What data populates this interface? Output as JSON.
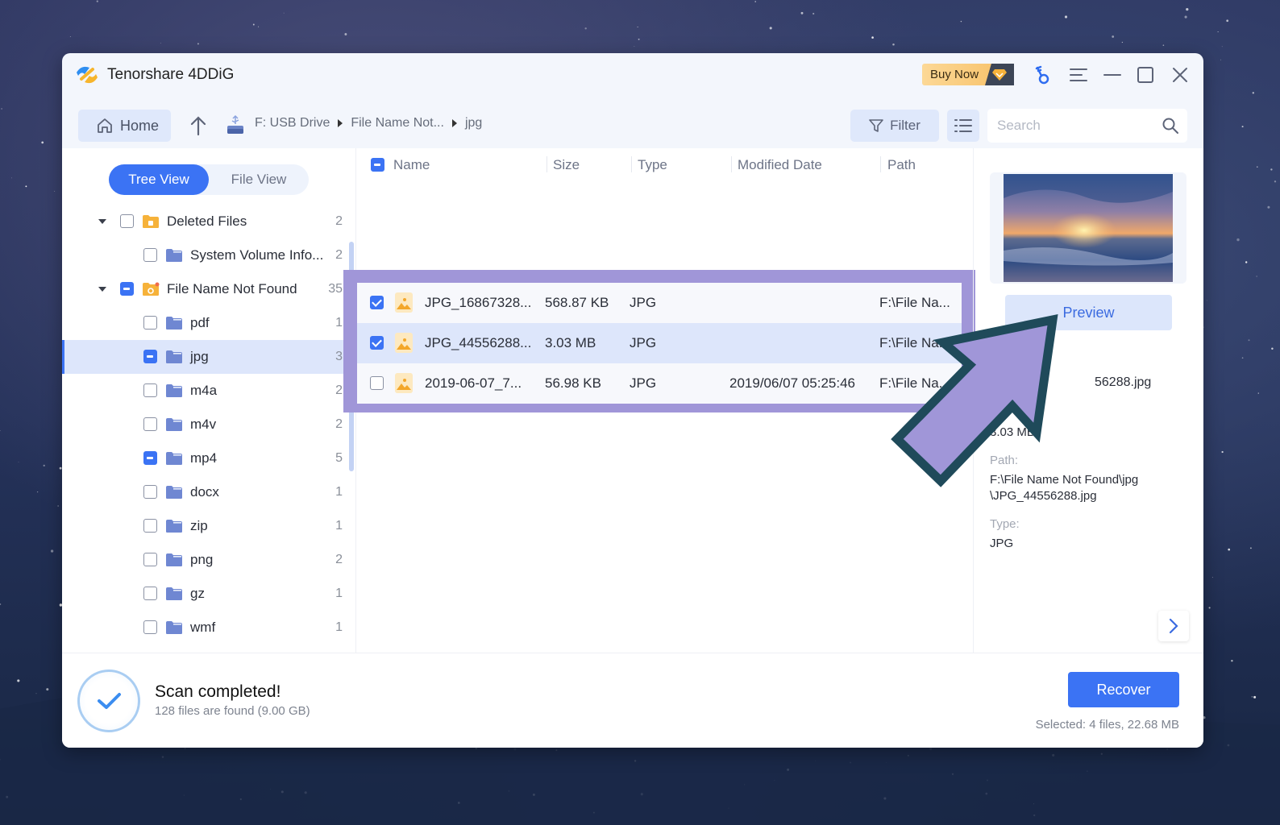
{
  "app": {
    "title": "Tenorshare 4DDiG",
    "buy_now_label": "Buy Now"
  },
  "titlebar_icons": [
    "key-icon",
    "menu-icon",
    "minimize-icon",
    "maximize-icon",
    "close-icon"
  ],
  "toolbar": {
    "home_label": "Home",
    "breadcrumb": [
      "F: USB Drive",
      "File Name Not...",
      "jpg"
    ],
    "filter_label": "Filter",
    "search_placeholder": "Search",
    "search_value": ""
  },
  "view_toggle": {
    "options": [
      "Tree View",
      "File View"
    ],
    "active": "Tree View"
  },
  "tree": [
    {
      "label": "Deleted Files",
      "count": "2",
      "level": 0,
      "expanded": true,
      "state": "unchecked",
      "folder": "trash-folder"
    },
    {
      "label": "System Volume Info...",
      "count": "2",
      "level": 1,
      "state": "unchecked",
      "folder": "folder"
    },
    {
      "label": "File Name Not Found",
      "count": "35",
      "level": 0,
      "expanded": true,
      "state": "partial",
      "folder": "unknown-folder"
    },
    {
      "label": "pdf",
      "count": "1",
      "level": 1,
      "state": "unchecked",
      "folder": "folder"
    },
    {
      "label": "jpg",
      "count": "3",
      "level": 1,
      "state": "partial",
      "folder": "folder",
      "selected": true
    },
    {
      "label": "m4a",
      "count": "2",
      "level": 1,
      "state": "unchecked",
      "folder": "folder"
    },
    {
      "label": "m4v",
      "count": "2",
      "level": 1,
      "state": "unchecked",
      "folder": "folder"
    },
    {
      "label": "mp4",
      "count": "5",
      "level": 1,
      "state": "partial",
      "folder": "folder"
    },
    {
      "label": "docx",
      "count": "1",
      "level": 1,
      "state": "unchecked",
      "folder": "folder"
    },
    {
      "label": "zip",
      "count": "1",
      "level": 1,
      "state": "unchecked",
      "folder": "folder"
    },
    {
      "label": "png",
      "count": "2",
      "level": 1,
      "state": "unchecked",
      "folder": "folder"
    },
    {
      "label": "gz",
      "count": "1",
      "level": 1,
      "state": "unchecked",
      "folder": "folder"
    },
    {
      "label": "wmf",
      "count": "1",
      "level": 1,
      "state": "unchecked",
      "folder": "folder"
    }
  ],
  "file_table": {
    "header_checkbox": "partial",
    "columns": [
      "Name",
      "Size",
      "Type",
      "Modified Date",
      "Path"
    ],
    "rows": [
      {
        "name": "JPG_16867328...",
        "size": "568.87 KB",
        "type": "JPG",
        "modified": "",
        "path": "F:\\File Na...",
        "checked": true,
        "selected": false
      },
      {
        "name": "JPG_44556288...",
        "size": "3.03 MB",
        "type": "JPG",
        "modified": "",
        "path": "F:\\File Na...",
        "checked": true,
        "selected": true
      },
      {
        "name": "2019-06-07_7...",
        "size": "56.98 KB",
        "type": "JPG",
        "modified": "2019/06/07 05:25:46",
        "path": "F:\\File Na...",
        "checked": false,
        "selected": false
      }
    ]
  },
  "details": {
    "preview_label": "Preview",
    "name_partial": "56288.jpg",
    "size_partial": "3.03 MB",
    "path_label": "Path:",
    "path_value_line1": "F:\\File Name Not Found\\jpg",
    "path_value_line2": "\\JPG_44556288.jpg",
    "type_label": "Type:",
    "type_value": "JPG"
  },
  "footer": {
    "scan_title": "Scan completed!",
    "scan_subtitle": "128 files are found (9.00 GB)",
    "recover_label": "Recover",
    "selected_info": "Selected: 4 files, 22.68 MB"
  },
  "colors": {
    "accent": "#3b73f4",
    "highlight_overlay": "#a096d8",
    "arrow_fill": "#a096d8",
    "arrow_stroke": "#1f4a5a"
  }
}
